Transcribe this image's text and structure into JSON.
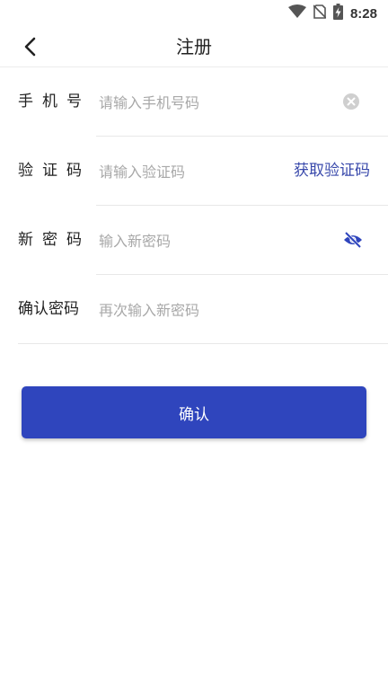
{
  "status_bar": {
    "time": "8:28",
    "icons": [
      "wifi-icon",
      "no-sim-icon",
      "battery-charging-icon"
    ]
  },
  "nav": {
    "title": "注册",
    "back_icon": "chevron-left-icon"
  },
  "form": {
    "phone": {
      "label": "手机号",
      "placeholder": "请输入手机号码",
      "value": "",
      "clear_icon": "clear-circle-icon"
    },
    "code": {
      "label": "验证码",
      "placeholder": "请输入验证码",
      "value": "",
      "button_label": "获取验证码"
    },
    "password": {
      "label": "新密码",
      "placeholder": "输入新密码",
      "value": "",
      "toggle_icon": "eye-off-icon"
    },
    "confirm_password": {
      "label": "确认密码",
      "placeholder": "再次输入新密码",
      "value": ""
    }
  },
  "confirm_button": {
    "label": "确认"
  },
  "colors": {
    "accent": "#2f45bd",
    "link": "#3949ab",
    "placeholder": "#a8a8a8",
    "divider": "#e8e8e8"
  }
}
